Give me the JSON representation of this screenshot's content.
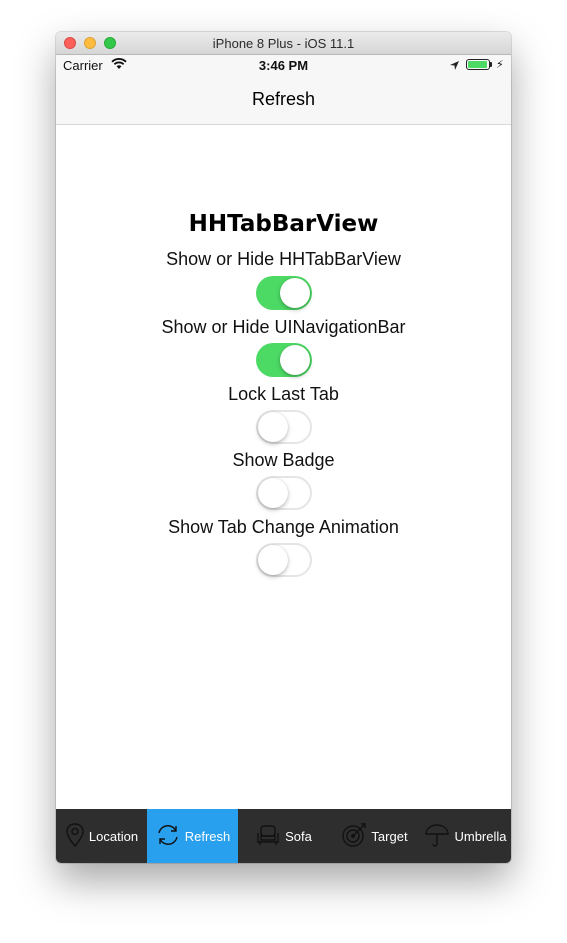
{
  "window": {
    "title": "iPhone 8 Plus - iOS 11.1"
  },
  "status_bar": {
    "carrier": "Carrier",
    "time": "3:46 PM",
    "battery_color": "#4cd964"
  },
  "nav": {
    "title": "Refresh"
  },
  "main": {
    "title": "HHTabBarView",
    "options": [
      {
        "label": "Show or Hide HHTabBarView",
        "on": true
      },
      {
        "label": "Show or Hide UINavigationBar",
        "on": true
      },
      {
        "label": "Lock Last Tab",
        "on": false
      },
      {
        "label": "Show Badge",
        "on": false
      },
      {
        "label": "Show Tab Change Animation",
        "on": false
      }
    ]
  },
  "tabs": [
    {
      "label": "Location",
      "icon": "location-pin-icon",
      "active": false
    },
    {
      "label": "Refresh",
      "icon": "refresh-icon",
      "active": true
    },
    {
      "label": "Sofa",
      "icon": "sofa-icon",
      "active": false
    },
    {
      "label": "Target",
      "icon": "target-icon",
      "active": false
    },
    {
      "label": "Umbrella",
      "icon": "umbrella-icon",
      "active": false
    }
  ],
  "colors": {
    "switch_on": "#4cd964",
    "tab_active": "#29a0ee",
    "tab_bar": "#2e2e2e"
  }
}
